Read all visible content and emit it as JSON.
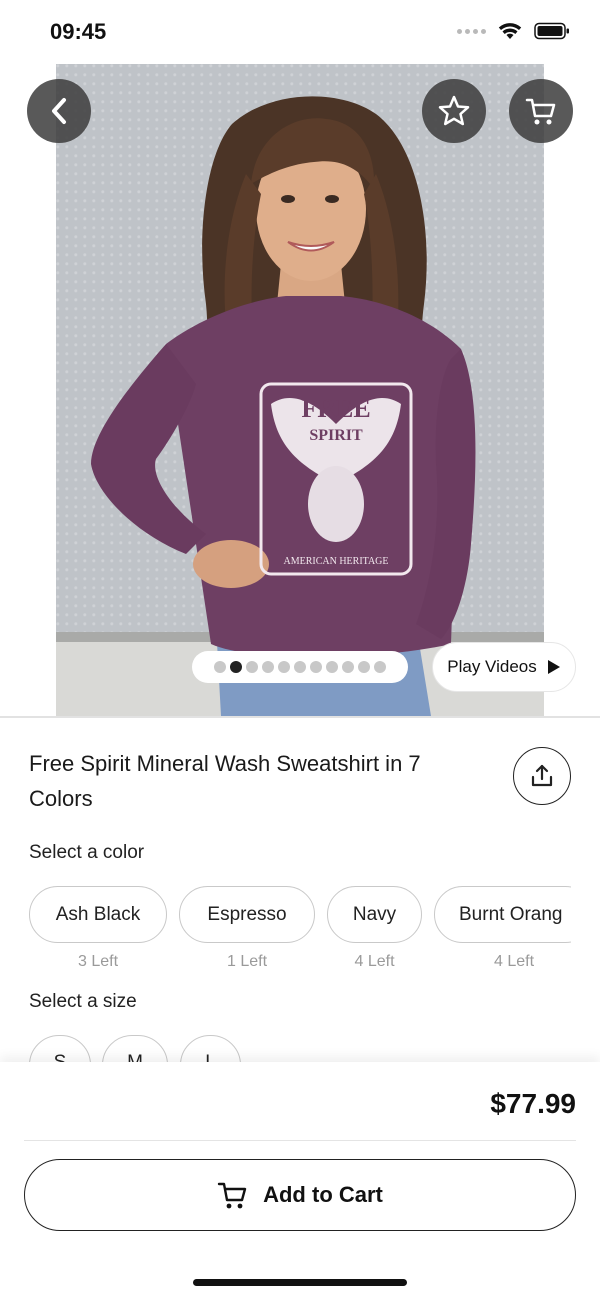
{
  "status_bar": {
    "time": "09:45"
  },
  "header": {
    "back_icon": "chevron-left-icon",
    "favorite_icon": "star-icon",
    "cart_icon": "cart-icon"
  },
  "gallery": {
    "image_text": {
      "line1": "FREE",
      "line2": "SPIRIT",
      "line3": "AMERICAN HERITAGE"
    },
    "pages": 11,
    "active_page": 2,
    "play_videos_label": "Play Videos"
  },
  "product": {
    "title": "Free Spirit Mineral Wash Sweatshirt in 7 Colors",
    "share_icon": "share-icon"
  },
  "color_section": {
    "label": "Select a color",
    "options": [
      {
        "name": "Ash Black",
        "stock": "3 Left"
      },
      {
        "name": "Espresso",
        "stock": "1 Left"
      },
      {
        "name": "Navy",
        "stock": "4 Left"
      },
      {
        "name": "Burnt Orang",
        "stock": "4 Left"
      }
    ]
  },
  "size_section": {
    "label": "Select a size",
    "options": [
      "S",
      "M",
      "L"
    ]
  },
  "checkout": {
    "price": "$77.99",
    "add_to_cart_label": "Add to Cart"
  },
  "colors": {
    "accent": "#222222",
    "shirt": "#6e3f63",
    "overlay_button": "#3c3c3c"
  }
}
